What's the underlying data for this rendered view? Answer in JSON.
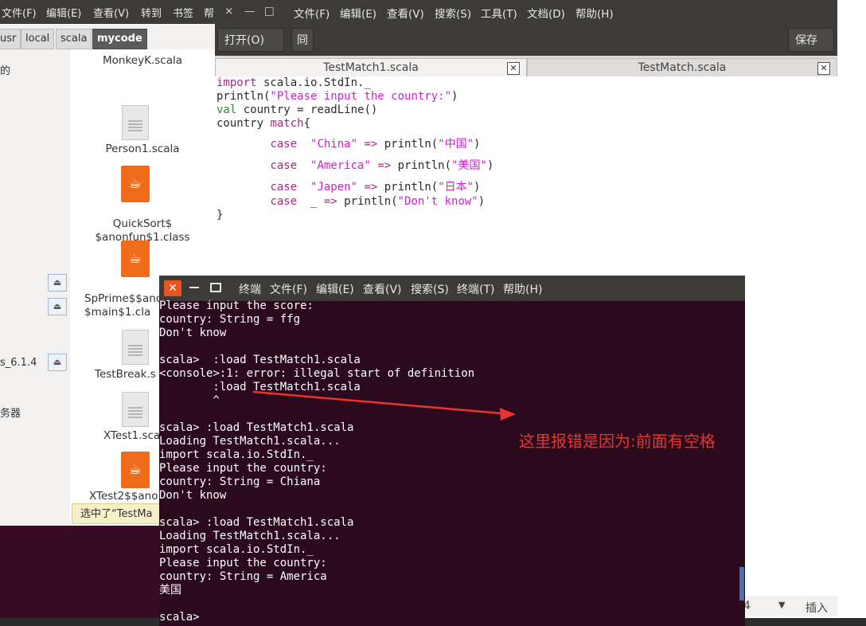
{
  "file_manager": {
    "menu": [
      "文件(F)",
      "编辑(E)",
      "查看(V)",
      "转到",
      "书签",
      "帮"
    ],
    "path": [
      "usr",
      "local",
      "scala",
      "mycode"
    ],
    "sidebar_texts": [
      "的",
      "s_6.1.4",
      "务器"
    ],
    "files": [
      {
        "name": "MonkeyK.scala",
        "icon": "text-file-icon"
      },
      {
        "name": "Person1.scala",
        "icon": "text-file-icon"
      },
      {
        "name": "QuickSort$\n$anonfun$1.class",
        "icon": "java-class-icon"
      },
      {
        "name": "SpPrime$$anc\n$main$1.cla",
        "icon": "java-class-icon"
      },
      {
        "name": "TestBreak.s",
        "icon": "text-file-icon"
      },
      {
        "name": "XTest1.sca",
        "icon": "text-file-icon"
      },
      {
        "name": "XTest2$$ano",
        "icon": "java-class-icon"
      }
    ],
    "tooltip": "选中了“TestMa"
  },
  "editor": {
    "window_controls": [
      "×",
      "—",
      "□"
    ],
    "menu": [
      "文件(F)",
      "编辑(E)",
      "查看(V)",
      "搜索(S)",
      "工具(T)",
      "文档(D)",
      "帮助(H)"
    ],
    "open_label": "打开(O)",
    "save_label": "保存(S)",
    "tabs": [
      "TestMatch1.scala",
      "TestMatch.scala"
    ],
    "status": {
      "col": "4",
      "mode": "插入"
    }
  },
  "terminal": {
    "title_items": [
      "终端",
      "文件(F)",
      "编辑(E)",
      "查看(V)",
      "搜索(S)",
      "终端(T)",
      "帮助(H)"
    ],
    "lines": [
      "Please input the score:",
      "country: String = ffg",
      "Don't know",
      "",
      "scala>  :load TestMatch1.scala",
      "<console>:1: error: illegal start of definition",
      "        :load TestMatch1.scala",
      "        ^",
      "",
      "scala> :load TestMatch1.scala",
      "Loading TestMatch1.scala...",
      "import scala.io.StdIn._",
      "Please input the country:",
      "country: String = Chiana",
      "Don't know",
      "",
      "scala> :load TestMatch1.scala",
      "Loading TestMatch1.scala...",
      "import scala.io.StdIn._",
      "Please input the country:",
      "country: String = America",
      "美国",
      "",
      "scala> "
    ]
  },
  "annotation": "这里报错是因为:前面有空格",
  "colors": {
    "annotation": "#e8342c",
    "terminal_bg": "#2c0a1e",
    "titlebar": "#3c3b37"
  }
}
